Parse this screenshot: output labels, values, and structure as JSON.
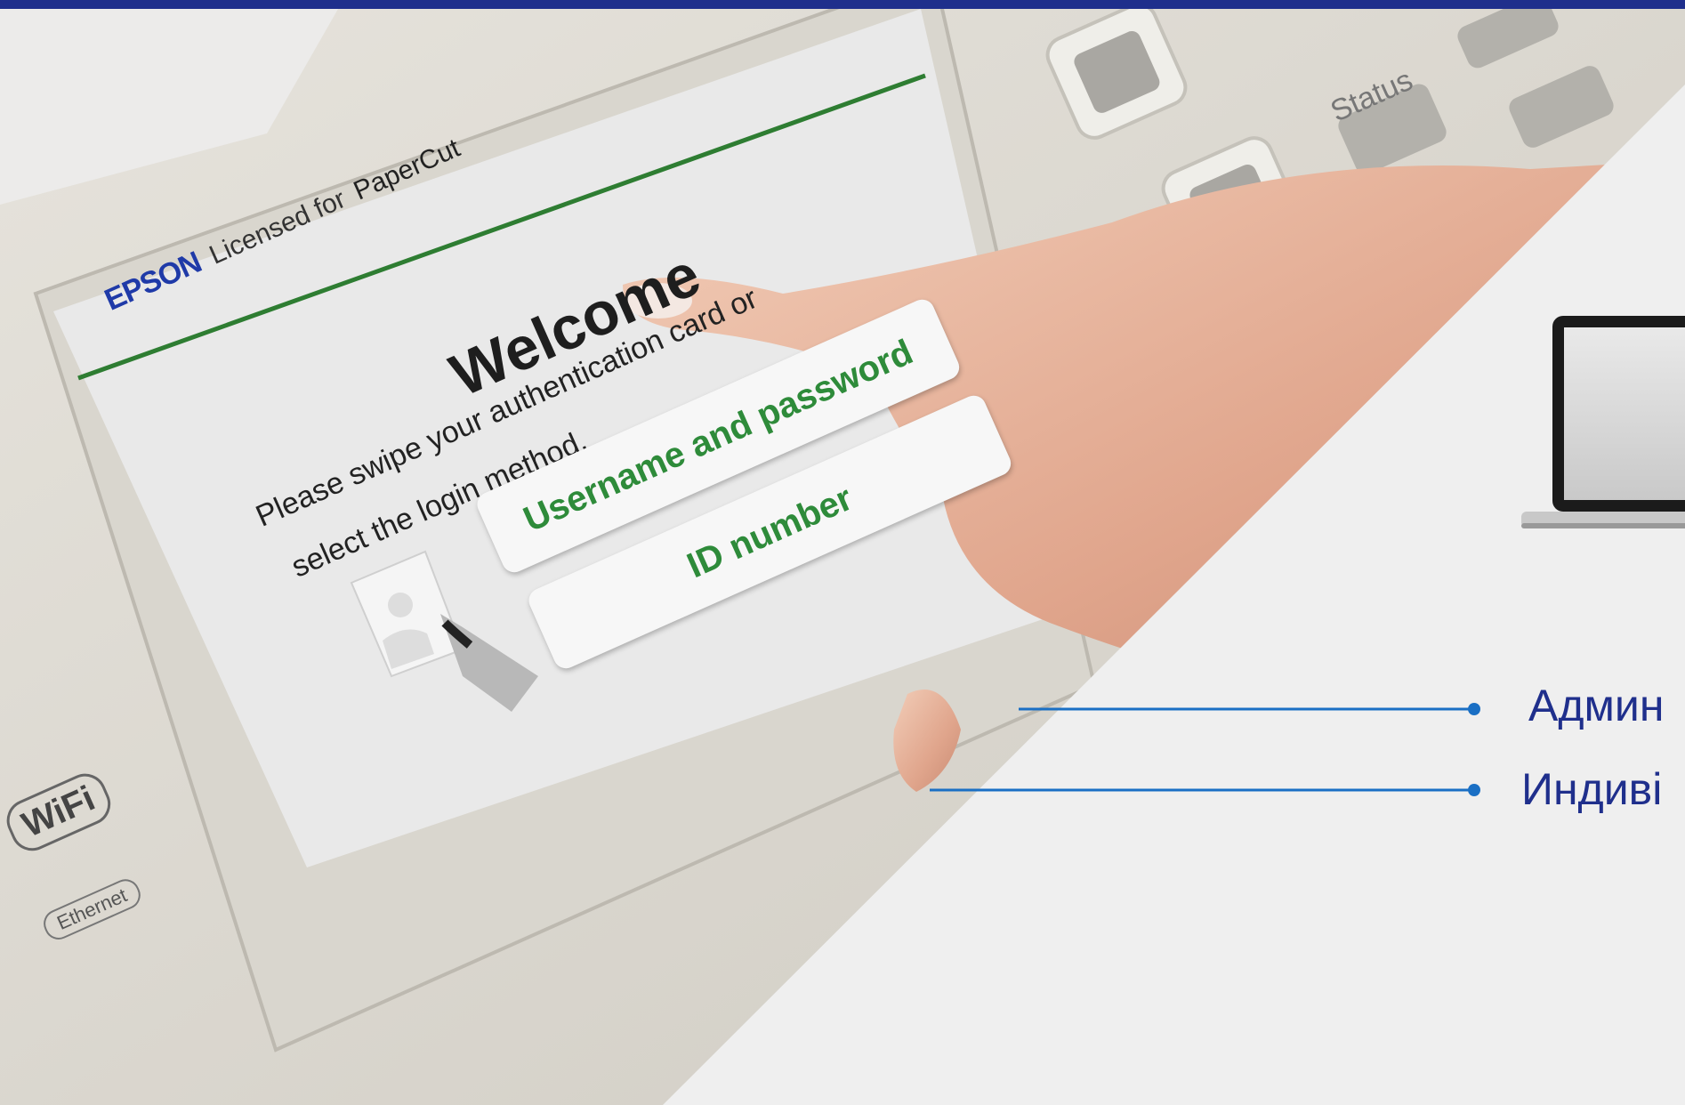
{
  "screen": {
    "brand": "EPSON",
    "licensed_text": "Licensed for",
    "papercut_text": "PaperCut",
    "welcome_title": "Welcome",
    "instruction_line1": "Please swipe your authentication card or",
    "instruction_line2": "select the login method.",
    "login_options": [
      {
        "label": "Username and password"
      },
      {
        "label": "ID number"
      }
    ]
  },
  "device": {
    "status_label": "Status",
    "wifi_label": "WiFi",
    "ethernet_label": "Ethernet"
  },
  "features": [
    {
      "label": "Админ"
    },
    {
      "label": "Индиві"
    }
  ],
  "colors": {
    "accent_blue": "#1f2f8c",
    "line_blue": "#1a6fc4",
    "papercut_green": "#2e8b3a"
  }
}
